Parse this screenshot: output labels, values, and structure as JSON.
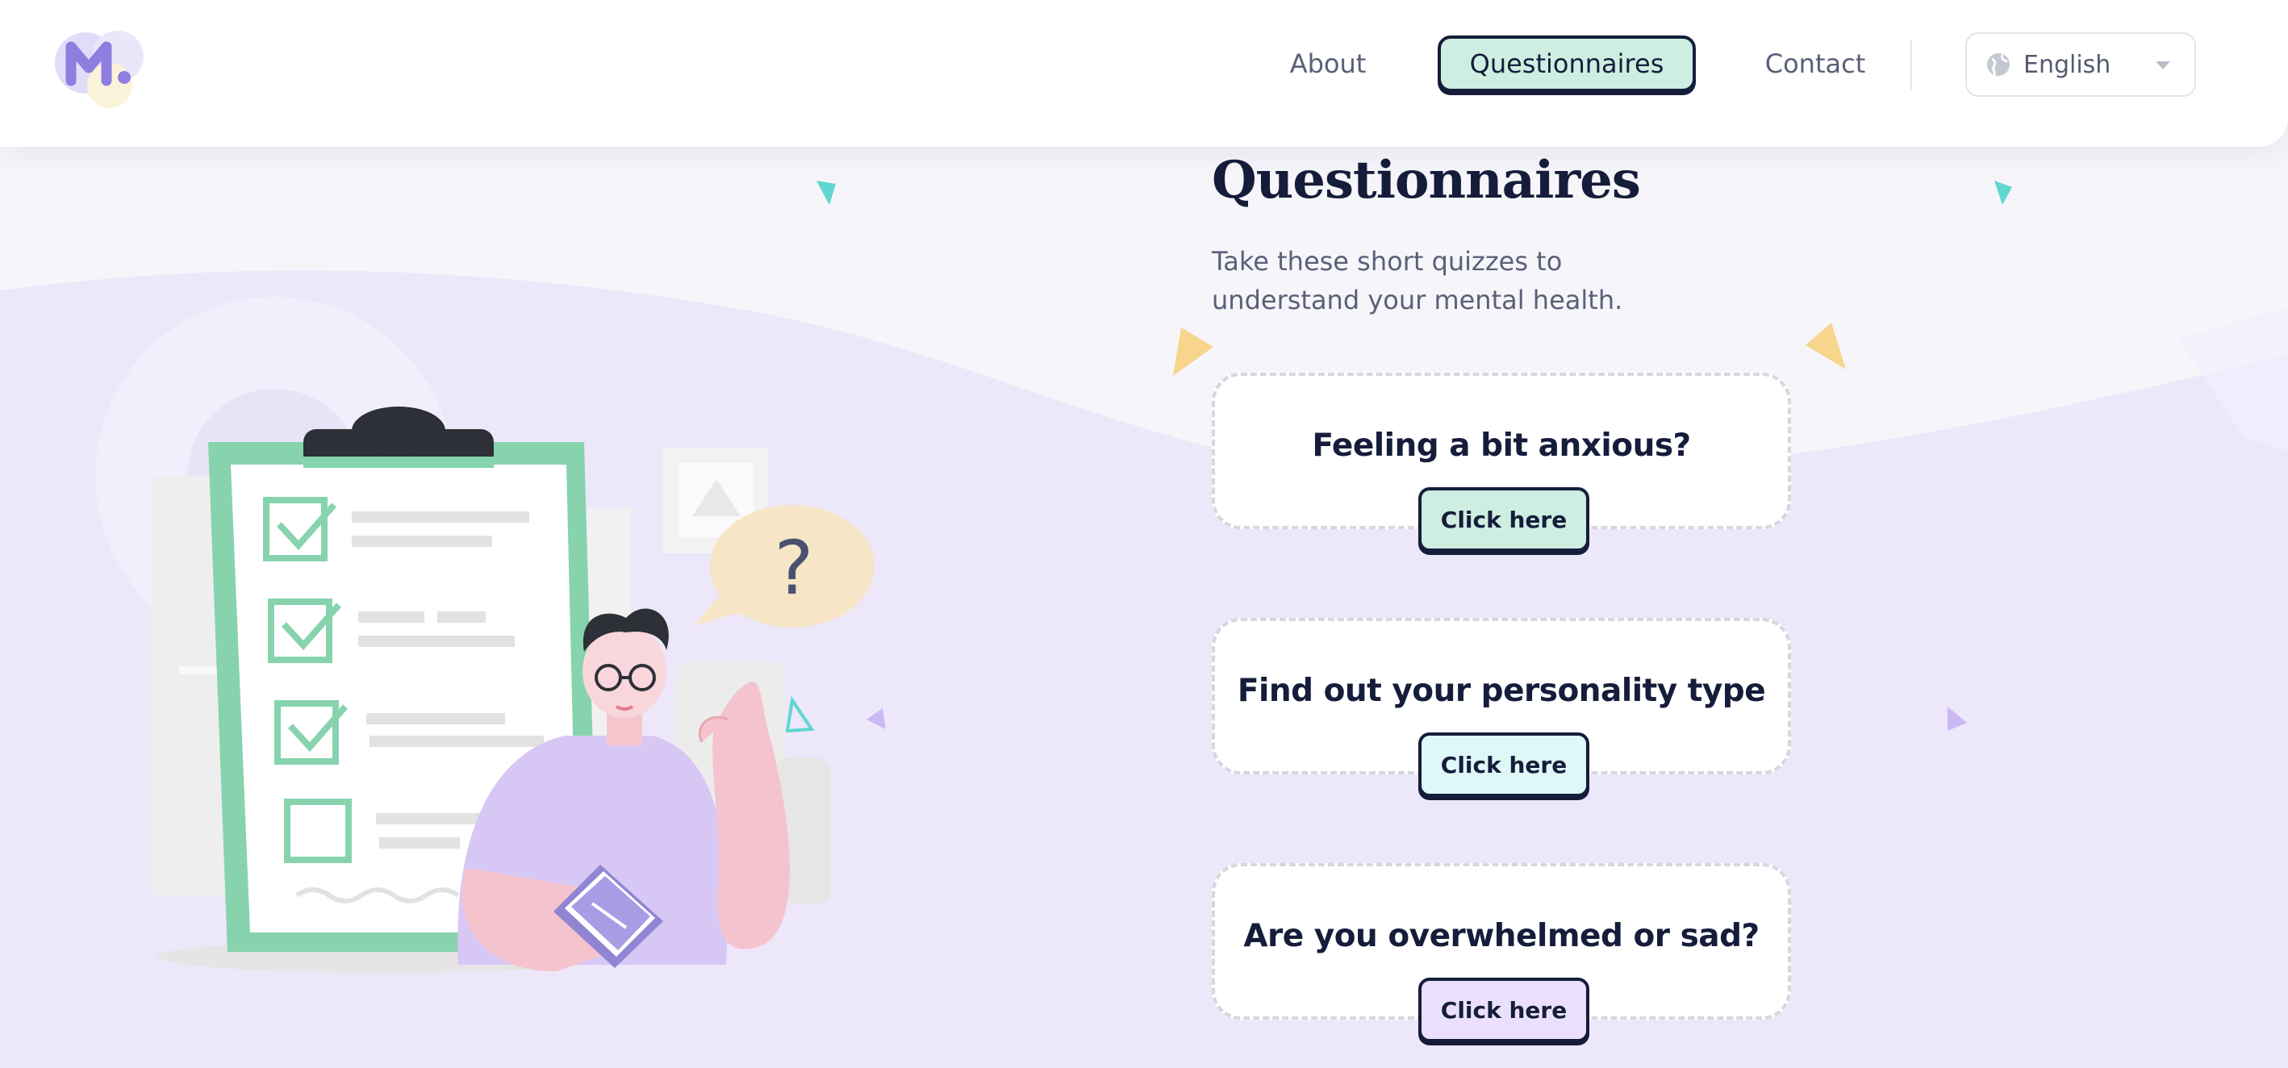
{
  "nav": {
    "about": "About",
    "questionnaires": "Questionnaires",
    "contact": "Contact"
  },
  "language": {
    "selected": "English"
  },
  "hero": {
    "title": "Questionnaires",
    "subtitle": "Take these short quizzes to understand your mental health."
  },
  "illustration": {
    "bubble_text": "?"
  },
  "cards": [
    {
      "title": "Feeling a bit anxious?",
      "button": "Click here",
      "button_color": "#cdeee0"
    },
    {
      "title": "Find out your personality type",
      "button": "Click here",
      "button_color": "#def7f7"
    },
    {
      "title": "Are you overwhelmed or sad?",
      "button": "Click here",
      "button_color": "#eae0fb"
    }
  ],
  "colors": {
    "navy": "#151d3b",
    "mint": "#86d3ae",
    "lavender": "#ece6fa",
    "teal_confetti": "#5fd6d2",
    "yellow_confetti": "#f7d58b"
  },
  "icons": {
    "logo": "logo-icon",
    "language": "globe-icon",
    "dropdown": "chevron-down-icon"
  }
}
